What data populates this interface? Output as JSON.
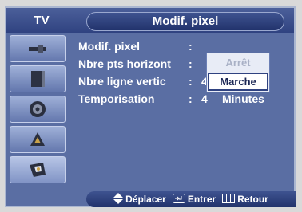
{
  "header": {
    "tv_label": "TV",
    "title": "Modif. pixel"
  },
  "sidebar": {
    "items": [
      {
        "icon": "antenna-plug-icon"
      },
      {
        "icon": "picture-icon"
      },
      {
        "icon": "speaker-icon"
      },
      {
        "icon": "channel-icon"
      },
      {
        "icon": "setup-icon"
      }
    ]
  },
  "menu": {
    "rows": [
      {
        "label": "Modif. pixel",
        "colon": ":",
        "value": ""
      },
      {
        "label": "Nbre pts horizont",
        "colon": ":",
        "value": ""
      },
      {
        "label": "Nbre ligne vertic",
        "colon": ":",
        "value": "4"
      },
      {
        "label": "Temporisation",
        "colon": ":",
        "value": "4",
        "unit": "Minutes"
      }
    ],
    "dropdown": {
      "options": [
        "Arrêt",
        "Marche"
      ],
      "selected": "Marche"
    }
  },
  "footer": {
    "move_label": "Déplacer",
    "enter_label": "Entrer",
    "return_label": "Retour"
  }
}
